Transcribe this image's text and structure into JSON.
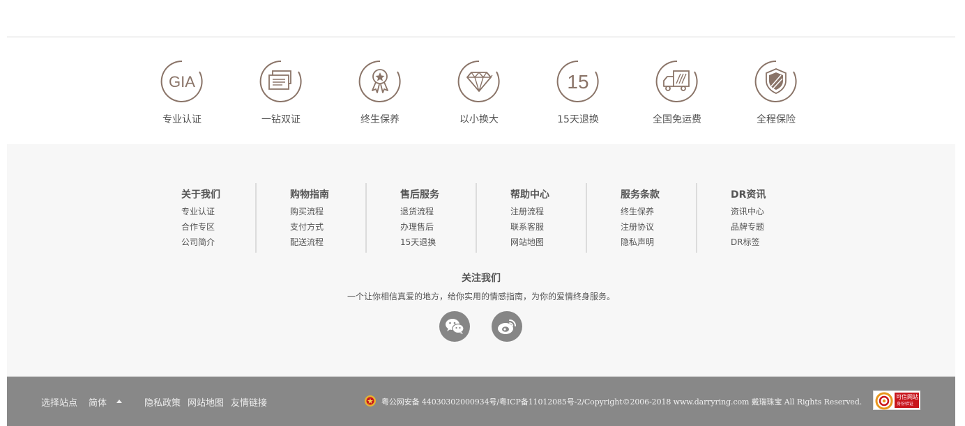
{
  "features": [
    {
      "label": "专业认证",
      "icon": "gia-icon",
      "icon_text": "GIA"
    },
    {
      "label": "一钻双证",
      "icon": "certificates-icon"
    },
    {
      "label": "终生保养",
      "icon": "medal-icon"
    },
    {
      "label": "以小换大",
      "icon": "diamond-icon"
    },
    {
      "label": "15天退换",
      "icon": "fifteen-days-icon",
      "icon_text": "15"
    },
    {
      "label": "全国免运费",
      "icon": "truck-icon"
    },
    {
      "label": "全程保险",
      "icon": "shield-icon"
    }
  ],
  "footer_columns": [
    {
      "title": "关于我们",
      "links": [
        "专业认证",
        "合作专区",
        "公司简介"
      ]
    },
    {
      "title": "购物指南",
      "links": [
        "购买流程",
        "支付方式",
        "配送流程"
      ]
    },
    {
      "title": "售后服务",
      "links": [
        "退货流程",
        "办理售后",
        "15天退换"
      ]
    },
    {
      "title": "帮助中心",
      "links": [
        "注册流程",
        "联系客服",
        "网站地图"
      ]
    },
    {
      "title": "服务条款",
      "links": [
        "终生保养",
        "注册协议",
        "隐私声明"
      ]
    },
    {
      "title": "DR资讯",
      "links": [
        "资讯中心",
        "品牌专题",
        "DR标签"
      ]
    }
  ],
  "follow": {
    "title": "关注我们",
    "description": "一个让你相信真爱的地方，给你实用的情感指南，为你的爱情终身服务。",
    "social": [
      "wechat-icon",
      "weibo-icon"
    ]
  },
  "bottom_bar": {
    "site_select": "选择站点",
    "language": "简体",
    "privacy": "隐私政策",
    "sitemap": "网站地图",
    "friend_links": "友情链接",
    "copyright": "粤公网安备 44030302000934号/粤ICP备11012085号-2/Copyright©2006-2018 www.darryring.com 戴瑞珠宝 All Rights Reserved.",
    "trust_badge_line1": "可信网站",
    "trust_badge_line2": "身份验证"
  },
  "colors": {
    "icon_stroke": "#8a7468",
    "links_bg": "#f7f7f7",
    "bottom_bg": "#888888",
    "social_bg": "#868686"
  }
}
